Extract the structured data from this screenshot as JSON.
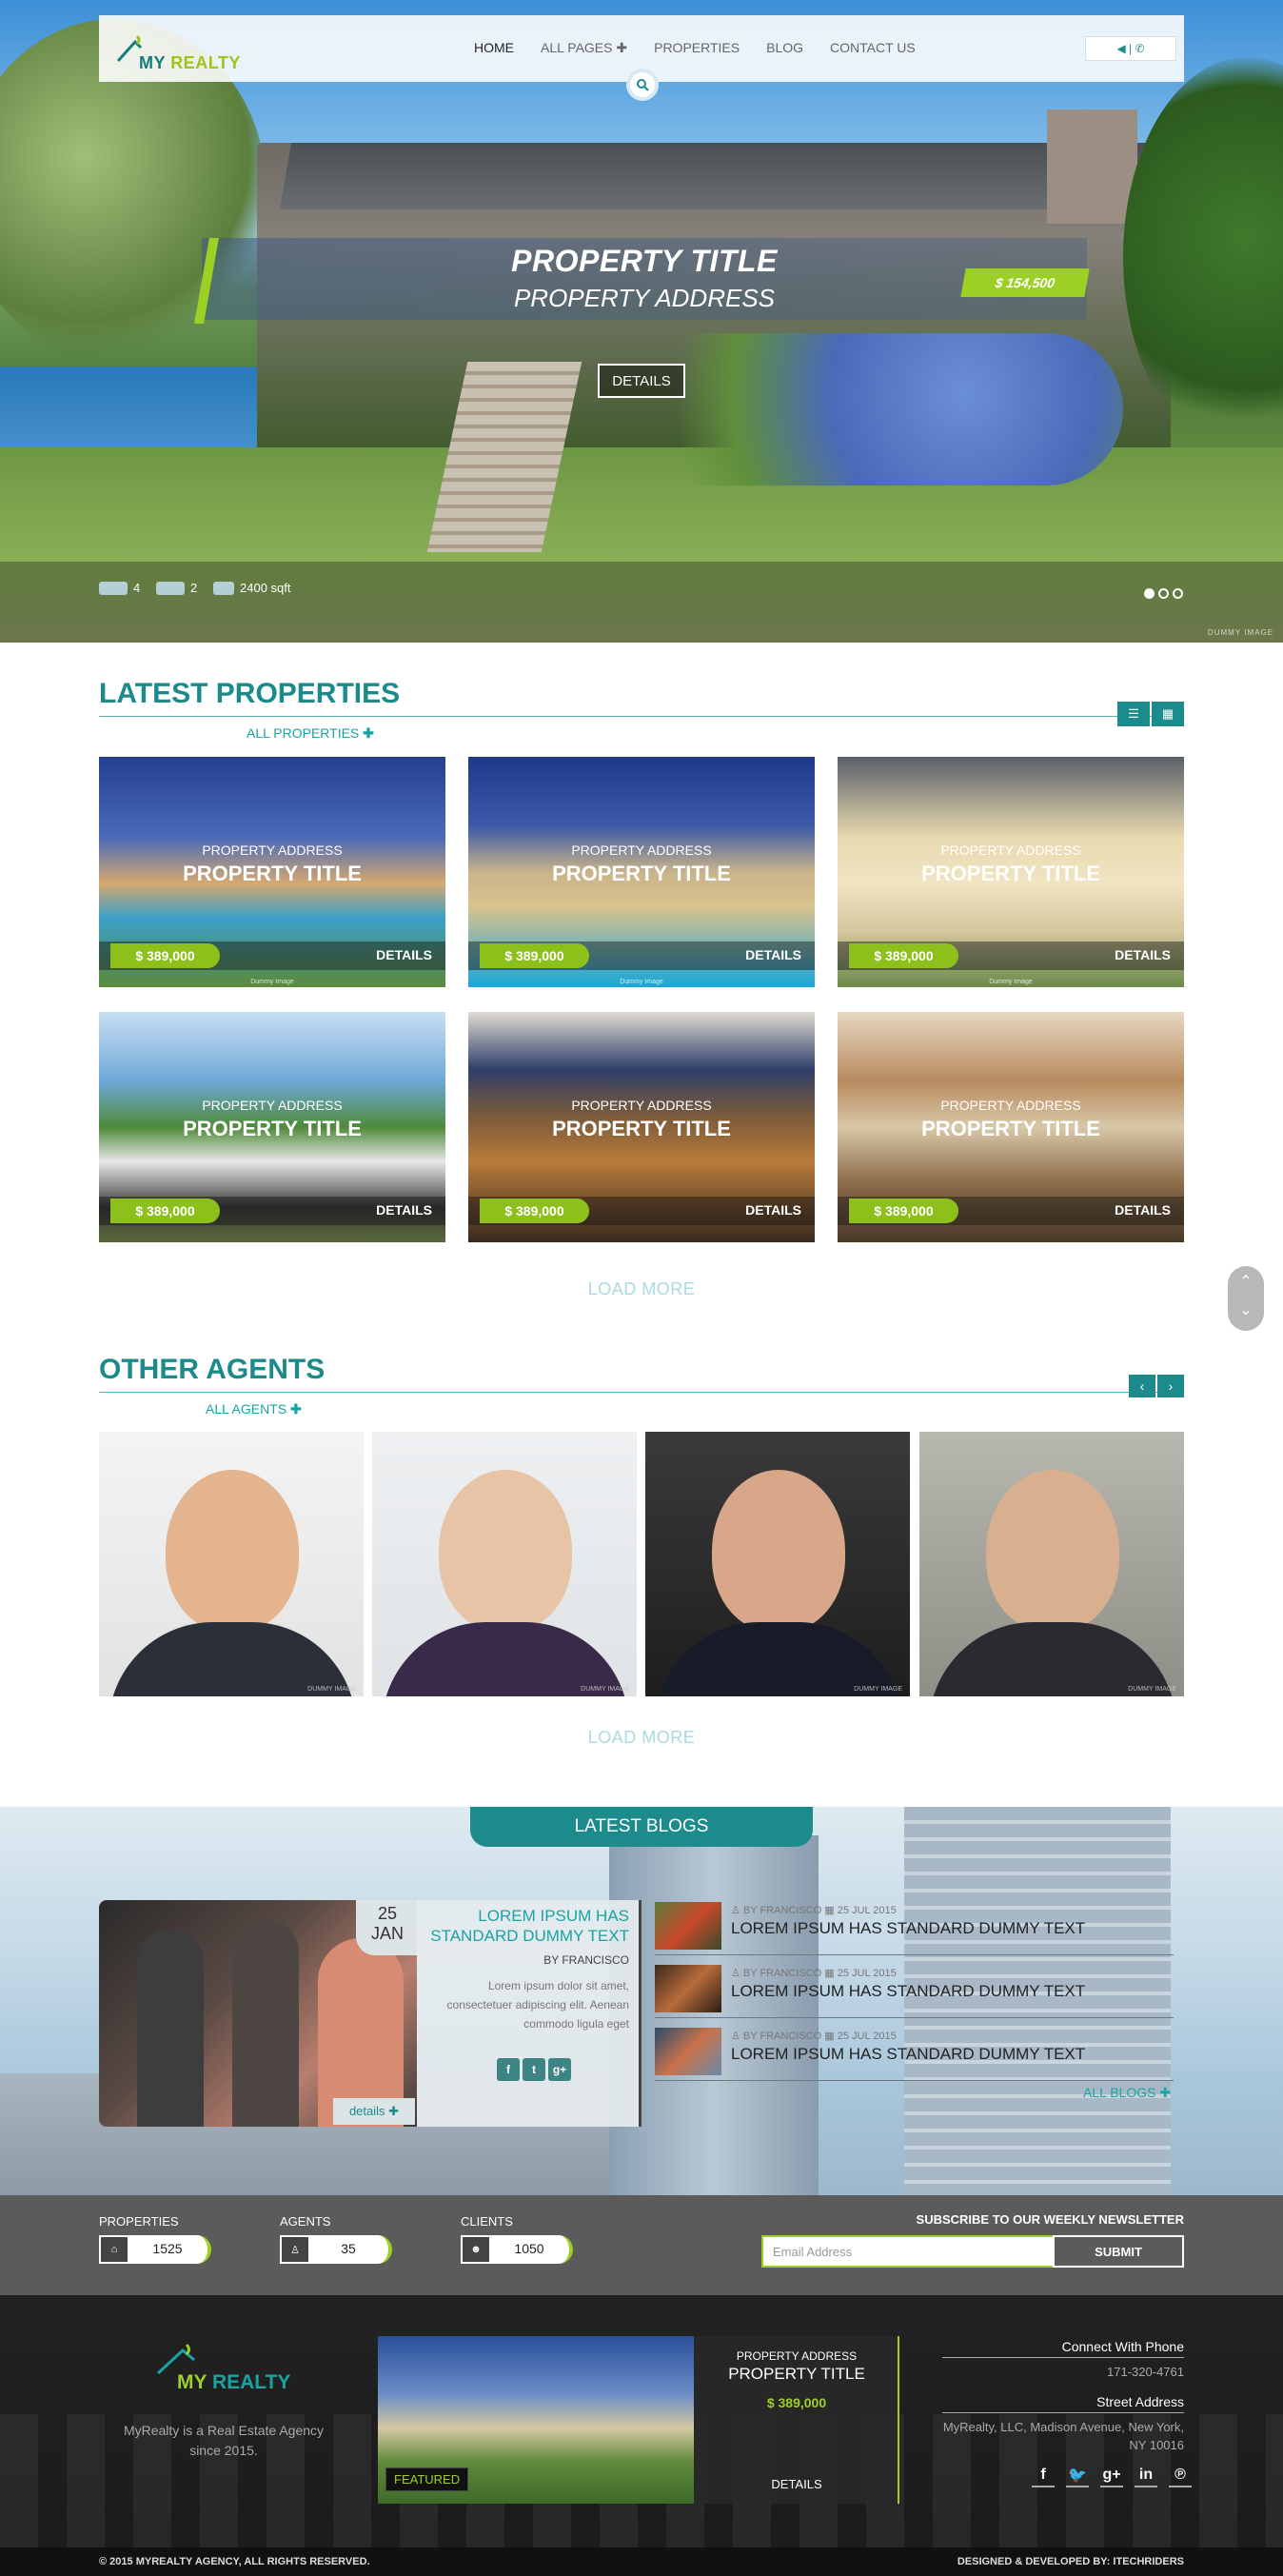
{
  "header": {
    "logo_text_a": "MY ",
    "logo_text_b": "REALTY",
    "nav": [
      "HOME",
      "ALL PAGES ✚",
      "PROPERTIES",
      "BLOG",
      "CONTACT US"
    ],
    "contact_icons": "◀ | ✆"
  },
  "hero": {
    "title": "PROPERTY TITLE",
    "address": "PROPERTY ADDRESS",
    "price": "$ 154,500",
    "details": "DETAILS",
    "beds": "4",
    "baths": "2",
    "area": "2400 sqft",
    "dummy": "DUMMY IMAGE"
  },
  "latest": {
    "title": "LATEST PROPERTIES",
    "link": "ALL PROPERTIES",
    "cards": [
      {
        "address": "PROPERTY ADDRESS",
        "title": "PROPERTY TITLE",
        "price": "$ 389,000",
        "details": "DETAILS",
        "dummy": "Dummy Image"
      },
      {
        "address": "PROPERTY ADDRESS",
        "title": "PROPERTY TITLE",
        "price": "$ 389,000",
        "details": "DETAILS",
        "dummy": "Dummy Image"
      },
      {
        "address": "PROPERTY ADDRESS",
        "title": "PROPERTY TITLE",
        "price": "$ 389,000",
        "details": "DETAILS",
        "dummy": "Dummy Image"
      },
      {
        "address": "PROPERTY ADDRESS",
        "title": "PROPERTY TITLE",
        "price": "$ 389,000",
        "details": "DETAILS",
        "dummy": ""
      },
      {
        "address": "PROPERTY ADDRESS",
        "title": "PROPERTY TITLE",
        "price": "$ 389,000",
        "details": "DETAILS",
        "dummy": ""
      },
      {
        "address": "PROPERTY ADDRESS",
        "title": "PROPERTY TITLE",
        "price": "$ 389,000",
        "details": "DETAILS",
        "dummy": ""
      }
    ],
    "load_more": "LOAD MORE"
  },
  "agents": {
    "title": "OTHER AGENTS",
    "link": "ALL AGENTS",
    "dummy": "DUMMY IMAGE",
    "load_more": "LOAD MORE"
  },
  "blogs": {
    "tab": "LATEST BLOGS",
    "featured": {
      "day": "25",
      "month": "JAN",
      "title": "LOREM IPSUM HAS STANDARD DUMMY TEXT",
      "by": "BY FRANCISCO",
      "text": "Lorem ipsum dolor sit amet, consectetuer adipiscing elit. Aenean commodo ligula eget",
      "more": "details ✚"
    },
    "list": [
      {
        "meta": "♙ BY FRANCISCO ▦ 25 JUL 2015",
        "title": "LOREM IPSUM HAS STANDARD DUMMY TEXT"
      },
      {
        "meta": "♙ BY FRANCISCO ▦ 25 JUL 2015",
        "title": "LOREM IPSUM HAS STANDARD DUMMY TEXT"
      },
      {
        "meta": "♙ BY FRANCISCO ▦ 25 JUL 2015",
        "title": "LOREM IPSUM HAS STANDARD DUMMY TEXT"
      }
    ],
    "all": "ALL BLOGS ✚"
  },
  "counters": {
    "properties": {
      "label": "PROPERTIES",
      "value": "1525"
    },
    "agents": {
      "label": "AGENTS",
      "value": "35"
    },
    "clients": {
      "label": "CLIENTS",
      "value": "1050"
    },
    "newsletter_title": "SUBSCRIBE TO OUR WEEKLY NEWSLETTER",
    "email_placeholder": "Email Address",
    "submit": "SUBMIT"
  },
  "footer": {
    "logo_a": "MY ",
    "logo_b": "REALTY",
    "about": "MyRealty is a Real Estate Agency since 2015.",
    "feat_address": "PROPERTY ADDRESS",
    "feat_title": "PROPERTY TITLE",
    "feat_price": "$ 389,000",
    "feat_tag": "FEATURED",
    "feat_details": "DETAILS",
    "phone_head": "Connect With Phone",
    "phone": "171-320-4761",
    "addr_head": "Street Address",
    "addr": "MyRealty, LLC, Madison Avenue, New York, NY 10016",
    "social": [
      "f",
      "🐦",
      "g+",
      "in",
      "℗"
    ],
    "copyright": "© 2015 MYREALTY AGENCY, ALL RIGHTS RESERVED.",
    "developer": "DESIGNED & DEVELOPED BY: ITECHRIDERS"
  },
  "colors": {
    "accent": "#1d8b8b",
    "lime": "#9cd025"
  }
}
